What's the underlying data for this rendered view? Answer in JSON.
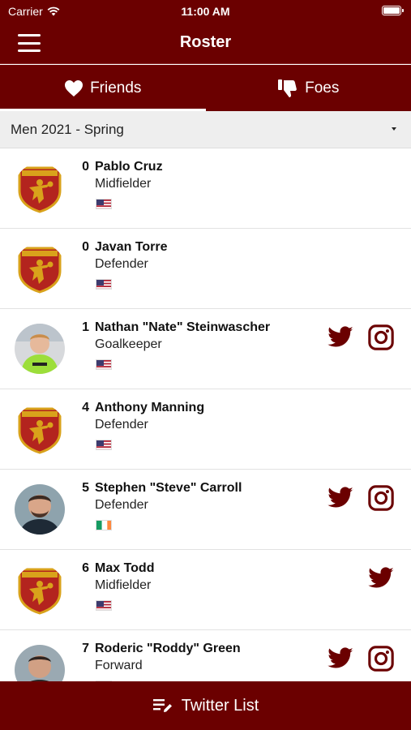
{
  "status_bar": {
    "carrier": "Carrier",
    "time": "11:00 AM"
  },
  "nav": {
    "title": "Roster"
  },
  "tabs": [
    {
      "label": "Friends",
      "icon": "heart-icon",
      "active": true
    },
    {
      "label": "Foes",
      "icon": "thumbs-down-icon",
      "active": false
    }
  ],
  "season": {
    "selected": "Men 2021 - Spring"
  },
  "players": [
    {
      "number": "0",
      "name": "Pablo Cruz",
      "position": "Midfielder",
      "flag": "US",
      "avatar": "club-crest",
      "twitter": false,
      "instagram": false
    },
    {
      "number": "0",
      "name": "Javan Torre",
      "position": "Defender",
      "flag": "US",
      "avatar": "club-crest",
      "twitter": false,
      "instagram": false
    },
    {
      "number": "1",
      "name": "Nathan \"Nate\" Steinwascher",
      "position": "Goalkeeper",
      "flag": "US",
      "avatar": "photo",
      "twitter": true,
      "instagram": true
    },
    {
      "number": "4",
      "name": "Anthony Manning",
      "position": "Defender",
      "flag": "US",
      "avatar": "club-crest",
      "twitter": false,
      "instagram": false
    },
    {
      "number": "5",
      "name": "Stephen \"Steve\" Carroll",
      "position": "Defender",
      "flag": "IE",
      "avatar": "photo",
      "twitter": true,
      "instagram": true
    },
    {
      "number": "6",
      "name": "Max Todd",
      "position": "Midfielder",
      "flag": "US",
      "avatar": "club-crest",
      "twitter": true,
      "instagram": false
    },
    {
      "number": "7",
      "name": "Roderic \"Roddy\" Green",
      "position": "Forward",
      "flag": "US",
      "avatar": "photo",
      "twitter": true,
      "instagram": true
    }
  ],
  "bottom_bar": {
    "label": "Twitter List",
    "icon": "list-edit-icon"
  },
  "colors": {
    "brand": "#6b0000",
    "crest_gold": "#d9a21b",
    "crest_red": "#b3241e"
  }
}
